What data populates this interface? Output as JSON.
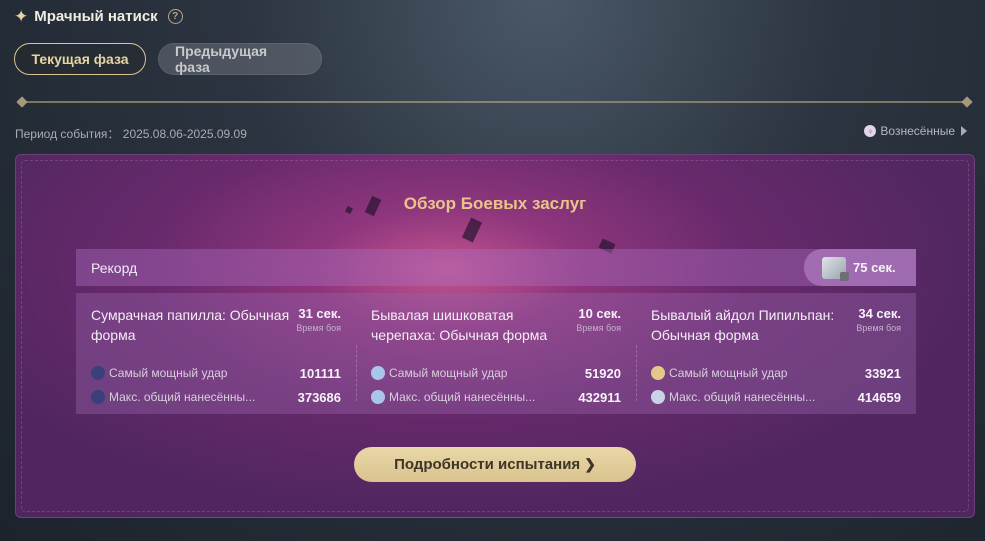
{
  "header": {
    "title": "Мрачный натиск",
    "sparkle_icon": "sparkle-icon",
    "help_icon": "help-icon"
  },
  "tabs": [
    {
      "label": "Текущая фаза",
      "active": true
    },
    {
      "label": "Предыдущая фаза",
      "active": false
    }
  ],
  "period": {
    "label": "Период события：",
    "value": "2025.08.06-2025.09.09"
  },
  "ascended": {
    "label": "Вознесённые"
  },
  "panel": {
    "title": "Обзор Боевых заслуг",
    "record": {
      "label": "Рекорд",
      "value": "75 сек."
    },
    "bosses": [
      {
        "name": "Сумрачная папилла: Обычная форма",
        "time": "31 сек.",
        "time_label": "Время боя",
        "stats": [
          {
            "label": "Самый мощный удар",
            "value": "101111",
            "color": "#3b3f7a"
          },
          {
            "label": "Макс. общий нанесённы...",
            "value": "373686",
            "color": "#3b3f7a"
          }
        ]
      },
      {
        "name": "Бывалая шишковатая черепаха: Обычная форма",
        "time": "10 сек.",
        "time_label": "Время боя",
        "stats": [
          {
            "label": "Самый мощный удар",
            "value": "51920",
            "color": "#a9c6e8"
          },
          {
            "label": "Макс. общий нанесённы...",
            "value": "432911",
            "color": "#a9c6e8"
          }
        ]
      },
      {
        "name": "Бывалый айдол Пипильпан: Обычная форма",
        "time": "34 сек.",
        "time_label": "Время боя",
        "stats": [
          {
            "label": "Самый мощный удар",
            "value": "33921",
            "color": "#e4c88a"
          },
          {
            "label": "Макс. общий нанесённы...",
            "value": "414659",
            "color": "#c8d4e6"
          }
        ]
      }
    ],
    "details_button": "Подробности испытания"
  }
}
